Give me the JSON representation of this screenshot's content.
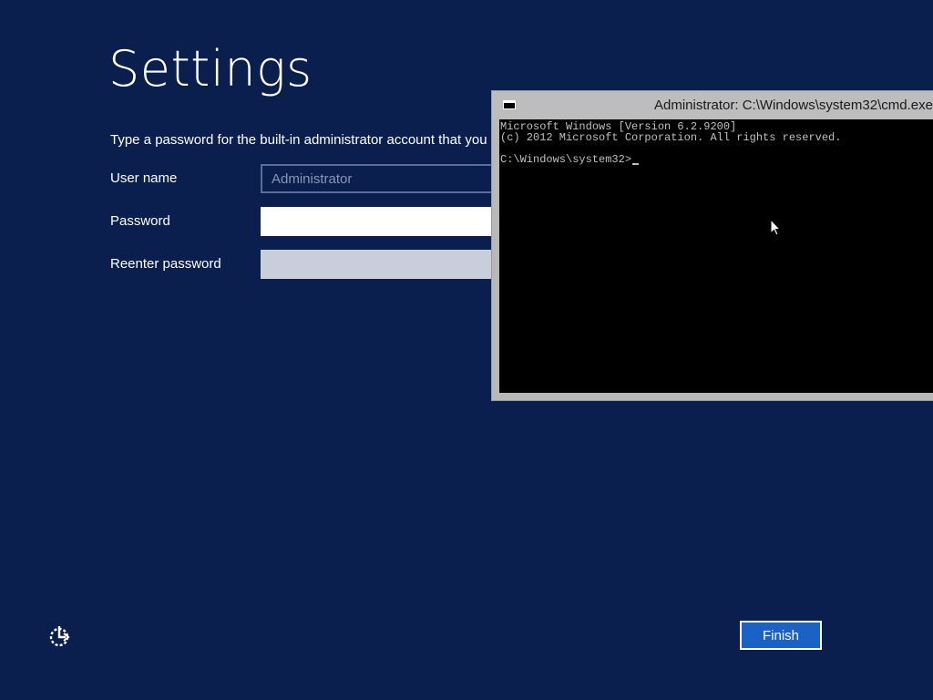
{
  "page": {
    "title": "Settings",
    "instructions": "Type a password for the built-in administrator account that you"
  },
  "form": {
    "username_label": "User name",
    "username_value": "Administrator",
    "password_label": "Password",
    "password_value": "",
    "reenter_label": "Reenter password",
    "reenter_value": ""
  },
  "footer": {
    "finish_label": "Finish",
    "ease_icon": "ease-of-access-icon"
  },
  "cmd": {
    "title": "Administrator: C:\\Windows\\system32\\cmd.exe",
    "icon": "cmd-app-icon",
    "lines": [
      "Microsoft Windows [Version 6.2.9200]",
      "(c) 2012 Microsoft Corporation. All rights reserved.",
      "",
      "C:\\Windows\\system32>"
    ]
  },
  "colors": {
    "background": "#0b1f4e",
    "accent": "#1b62c6",
    "console_bg": "#000000",
    "console_fg": "#c0c0c0"
  }
}
